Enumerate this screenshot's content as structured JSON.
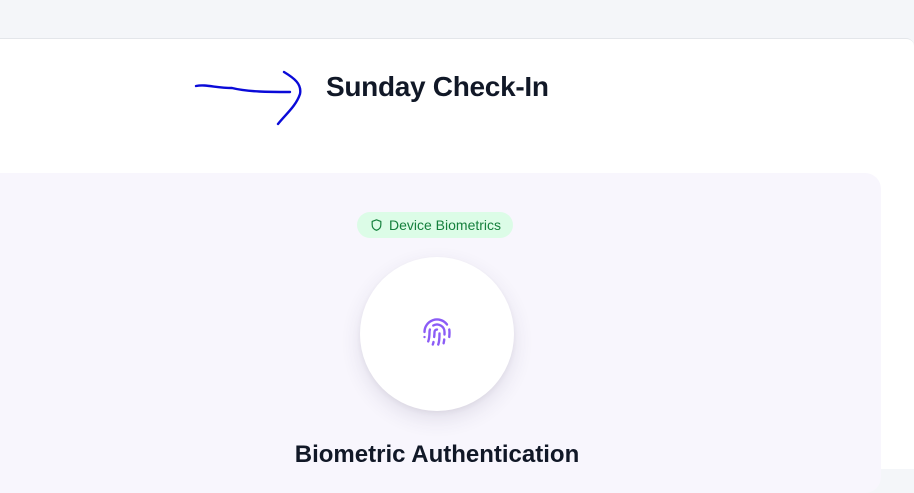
{
  "page": {
    "title": "Sunday Check-In"
  },
  "auth": {
    "badge_label": "Device Biometrics",
    "badge_icon": "shield-icon",
    "button_icon": "fingerprint-icon",
    "heading": "Biometric Authentication"
  },
  "colors": {
    "badge_background": "#dcfce7",
    "badge_text": "#15803d",
    "accent": "#8b5cf6",
    "card_background": "#f8f6fd",
    "annotation": "#0a0ad8"
  }
}
